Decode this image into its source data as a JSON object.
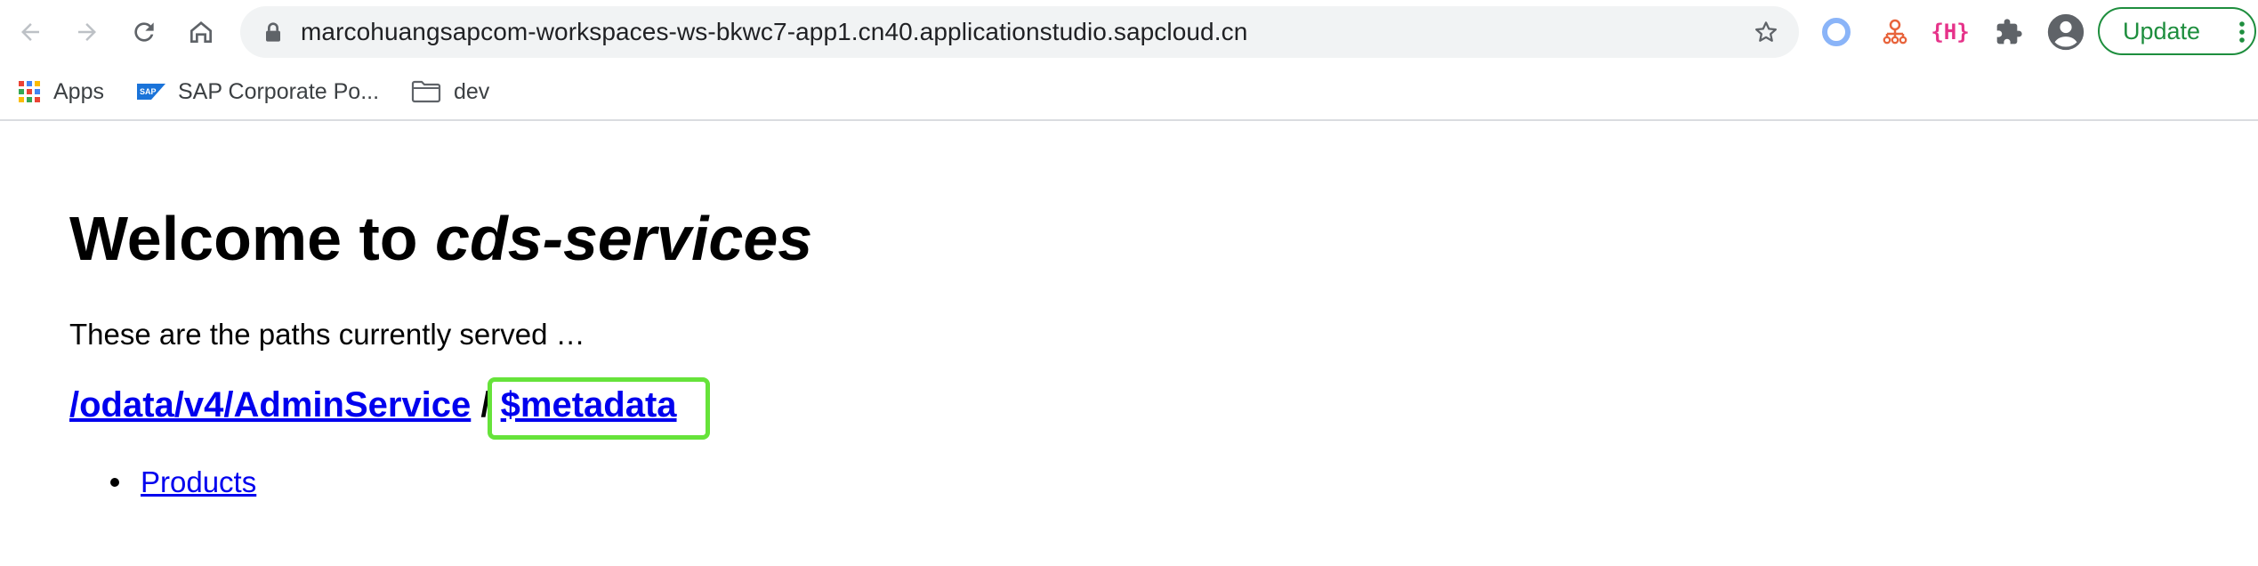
{
  "browser": {
    "url": "marcohuangsapcom-workspaces-ws-bkwc7-app1.cn40.applicationstudio.sapcloud.cn",
    "extension_h_label": "{H}",
    "update_label": "Update",
    "icons": {
      "back": "arrow-left-icon",
      "forward": "arrow-right-icon",
      "reload": "reload-icon",
      "home": "home-icon",
      "lock": "lock-icon",
      "bookmark_star": "star-icon",
      "extension_circle": "circle-extension-icon",
      "extension_sitemap": "sitemap-extension-icon",
      "extensions": "puzzle-icon",
      "profile": "account-icon",
      "menu": "vertical-dots-icon"
    },
    "colors": {
      "update_green": "#1e8e3e",
      "extension_h": "#e6338a",
      "extension_circle": "#8ab4f8"
    }
  },
  "bookmarks": [
    {
      "label": "Apps",
      "icon": "apps-grid-icon"
    },
    {
      "label": "SAP Corporate Po...",
      "icon": "sap-logo-icon"
    },
    {
      "label": "dev",
      "icon": "folder-icon"
    }
  ],
  "page": {
    "title_prefix": "Welcome to ",
    "title_emphasis": "cds-services",
    "intro": "These are the paths currently served …",
    "service_path": "/odata/v4/AdminService",
    "separator": "/",
    "metadata_link": "$metadata",
    "entities": [
      "Products"
    ],
    "highlight_color": "#66e33a",
    "link_color": "#0000ee"
  }
}
